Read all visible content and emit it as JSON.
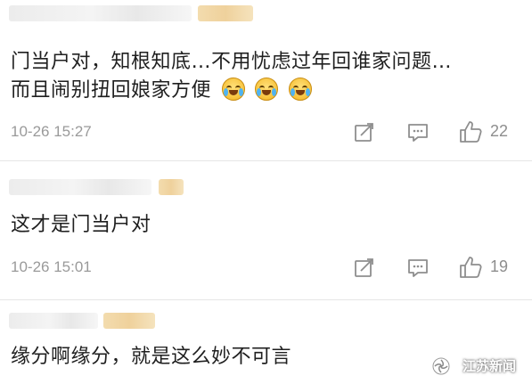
{
  "comments": [
    {
      "text_line1": "门当户对，知根知底…不用忧虑过年回谁家问题…",
      "text_line2": "而且闹别扭回娘家方便",
      "time": "10-26 15:27",
      "likes": "22"
    },
    {
      "text_line1": "这才是门当户对",
      "time": "10-26 15:01",
      "likes": "19"
    },
    {
      "text_line1": "缘分啊缘分，就是这么妙不可言"
    }
  ],
  "watermark": {
    "text": "江苏新闻"
  },
  "icons": {
    "emoji": "laugh-cry-emoji-icon",
    "repost": "repost-icon",
    "comment": "comment-icon",
    "like": "thumbs-up-icon"
  }
}
